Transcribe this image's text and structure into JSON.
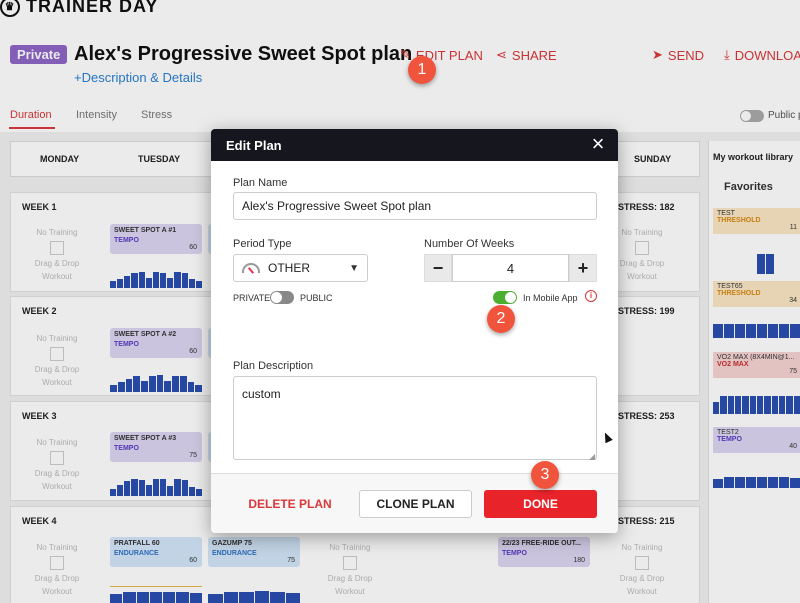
{
  "app": {
    "logo_text": "TRAINER DAY",
    "logo_icon": "trophy-icon"
  },
  "header": {
    "privacy_badge": "Private",
    "plan_title": "Alex's Progressive Sweet Spot plan",
    "description_link": "+Description & Details",
    "actions": {
      "edit_plan": "EDIT PLAN",
      "share": "SHARE",
      "send": "SEND",
      "download": "DOWNLOA"
    }
  },
  "tabs": {
    "duration": "Duration",
    "intensity": "Intensity",
    "stress": "Stress",
    "public_label": "Public p"
  },
  "days": [
    "MONDAY",
    "TUESDAY",
    "SUNDAY"
  ],
  "weeks": [
    {
      "label": "WEEK 1",
      "stress": "STRESS: 182"
    },
    {
      "label": "WEEK 2",
      "stress": "STRESS: 199"
    },
    {
      "label": "WEEK 3",
      "stress": "STRESS: 253"
    },
    {
      "label": "WEEK 4",
      "stress": "STRESS: 215"
    }
  ],
  "empty_cell": {
    "line1": "No Training",
    "line2": "Drag & Drop",
    "line3": "Workout"
  },
  "workouts": [
    {
      "name": "SWEET SPOT A #1",
      "zone": "TEMPO",
      "num": "60"
    },
    {
      "name": "SWEET SPOT A #2",
      "zone": "TEMPO",
      "num": "60"
    },
    {
      "name": "SWEET SPOT A #3",
      "zone": "TEMPO",
      "num": "75"
    },
    {
      "name": "PRATFALL 60",
      "zone": "ENDURANCE",
      "num": "60"
    },
    {
      "name": "GAZUMP 75",
      "zone": "ENDURANCE",
      "num": "75"
    },
    {
      "name": "22/23 FREE-RIDE OUT...",
      "zone": "TEMPO",
      "num": "180"
    }
  ],
  "library": {
    "title": "My workout library",
    "favorites": "Favorites",
    "items": [
      {
        "name": "TEST",
        "zone": "THRESHOLD",
        "num": "11"
      },
      {
        "name": "TEST65",
        "zone": "THRESHOLD",
        "num": "34"
      },
      {
        "name": "VO2 MAX (8X4MIN@1...",
        "zone": "VO2 MAX",
        "num": "75"
      },
      {
        "name": "TEST2",
        "zone": "TEMPO",
        "num": "40"
      }
    ]
  },
  "modal": {
    "title": "Edit Plan",
    "close_icon": "close-icon",
    "plan_name_label": "Plan Name",
    "plan_name_value": "Alex's Progressive Sweet Spot plan",
    "period_type_label": "Period Type",
    "period_type_value": "OTHER",
    "weeks_label": "Number Of Weeks",
    "weeks_value": "4",
    "minus": "−",
    "plus": "+",
    "private_label": "PRIVATE",
    "public_label": "PUBLIC",
    "mobile_label": "In Mobile App",
    "mobile_enabled": true,
    "public_enabled": false,
    "description_label": "Plan Description",
    "description_value": "custom",
    "delete_button": "DELETE PLAN",
    "clone_button": "CLONE PLAN",
    "done_button": "DONE"
  },
  "markers": [
    "1",
    "2",
    "3"
  ],
  "colors": {
    "accent": "#d9383a",
    "done": "#e8242a",
    "marker": "#f0543c",
    "toggle_on": "#4caf32"
  }
}
